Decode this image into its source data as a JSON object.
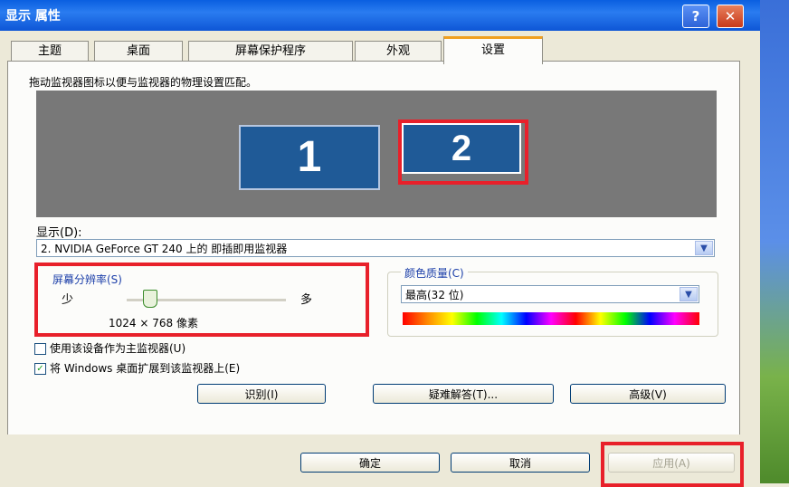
{
  "window": {
    "title": "显示 属性",
    "help_label": "?",
    "close_label": "✕"
  },
  "tabs": [
    {
      "label": "主题",
      "active": false
    },
    {
      "label": "桌面",
      "active": false
    },
    {
      "label": "屏幕保护程序",
      "active": false
    },
    {
      "label": "外观",
      "active": false
    },
    {
      "label": "设置",
      "active": true
    }
  ],
  "settings": {
    "instruction": "拖动监视器图标以便与监视器的物理设置匹配。",
    "monitors": [
      {
        "label": "1"
      },
      {
        "label": "2"
      }
    ],
    "display_label": "显示(D):",
    "display_value": "2. NVIDIA GeForce GT 240 上的 即插即用监视器",
    "resolution": {
      "title": "屏幕分辨率(S)",
      "less_label": "少",
      "more_label": "多",
      "value_text": "1024 × 768 像素",
      "slider_fraction": 0.1
    },
    "color_quality": {
      "title": "颜色质量(C)",
      "value": "最高(32 位)"
    },
    "checkboxes": [
      {
        "label": "使用该设备作为主监视器(U)",
        "checked": false
      },
      {
        "label": "将 Windows 桌面扩展到该监视器上(E)",
        "checked": true
      }
    ],
    "buttons": {
      "identify": "识别(I)",
      "troubleshoot": "疑难解答(T)...",
      "advanced": "高级(V)"
    }
  },
  "footer": {
    "ok": "确定",
    "cancel": "取消",
    "apply": "应用(A)"
  },
  "highlight_color": "#e8202a"
}
